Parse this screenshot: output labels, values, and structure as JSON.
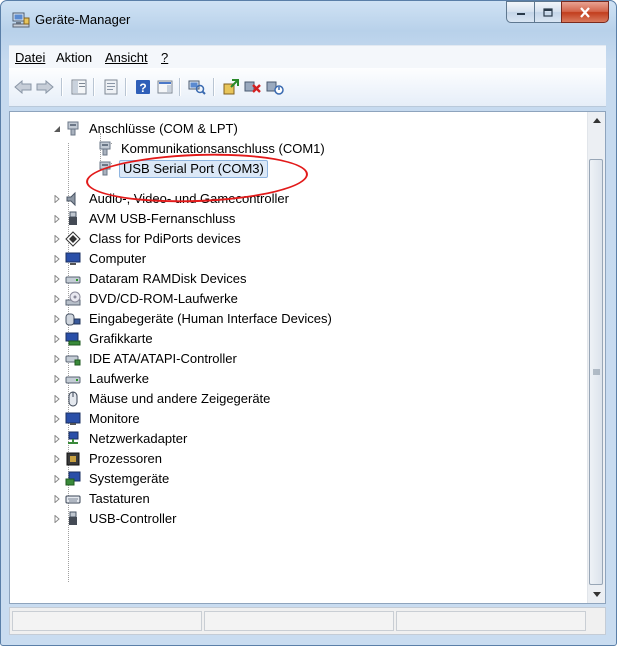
{
  "window": {
    "title": "Geräte-Manager",
    "buttons": {
      "minimize": "minimize",
      "maximize": "maximize",
      "close": "close"
    }
  },
  "menu": {
    "items": [
      {
        "label": "Datei",
        "key": "D"
      },
      {
        "label": "Aktion",
        "key": "k"
      },
      {
        "label": "Ansicht",
        "key": "A"
      },
      {
        "label": "?",
        "key": "?"
      }
    ]
  },
  "toolbar": {
    "icons": [
      "back-icon",
      "forward-icon",
      "properties-panel-icon",
      "show-hide-tree-icon",
      "help-icon",
      "details-icon",
      "scan-hardware-icon",
      "update-driver-icon",
      "uninstall-icon",
      "disable-icon"
    ]
  },
  "tree": {
    "items": [
      {
        "label": "Anschlüsse (COM & LPT)",
        "level": 0,
        "expanded": true,
        "icon": "port-icon"
      },
      {
        "label": "Kommunikationsanschluss (COM1)",
        "level": 1,
        "icon": "port-icon"
      },
      {
        "label": "USB Serial Port (COM3)",
        "level": 1,
        "icon": "port-icon",
        "selected": true
      },
      {
        "label": "Audio-, Video- und Gamecontroller",
        "level": 0,
        "icon": "speaker-icon"
      },
      {
        "label": "AVM USB-Fernanschluss",
        "level": 0,
        "icon": "usb-plug-icon"
      },
      {
        "label": "Class for PdiPorts devices",
        "level": 0,
        "icon": "diamond-icon"
      },
      {
        "label": "Computer",
        "level": 0,
        "icon": "computer-icon"
      },
      {
        "label": "Dataram RAMDisk Devices",
        "level": 0,
        "icon": "disk-drive-icon"
      },
      {
        "label": "DVD/CD-ROM-Laufwerke",
        "level": 0,
        "icon": "dvd-icon"
      },
      {
        "label": "Eingabegeräte (Human Interface Devices)",
        "level": 0,
        "icon": "hid-icon"
      },
      {
        "label": "Grafikkarte",
        "level": 0,
        "icon": "display-adapter-icon"
      },
      {
        "label": "IDE ATA/ATAPI-Controller",
        "level": 0,
        "icon": "ide-controller-icon"
      },
      {
        "label": "Laufwerke",
        "level": 0,
        "icon": "disk-drive-icon"
      },
      {
        "label": "Mäuse und andere Zeigegeräte",
        "level": 0,
        "icon": "mouse-icon"
      },
      {
        "label": "Monitore",
        "level": 0,
        "icon": "monitor-icon"
      },
      {
        "label": "Netzwerkadapter",
        "level": 0,
        "icon": "network-icon"
      },
      {
        "label": "Prozessoren",
        "level": 0,
        "icon": "processor-icon"
      },
      {
        "label": "Systemgeräte",
        "level": 0,
        "icon": "system-device-icon"
      },
      {
        "label": "Tastaturen",
        "level": 0,
        "icon": "keyboard-icon"
      },
      {
        "label": "USB-Controller",
        "level": 0,
        "icon": "usb-plug-icon"
      }
    ]
  },
  "colors": {
    "highlight": "#e21a1a",
    "selection": "#dbe8f7"
  }
}
